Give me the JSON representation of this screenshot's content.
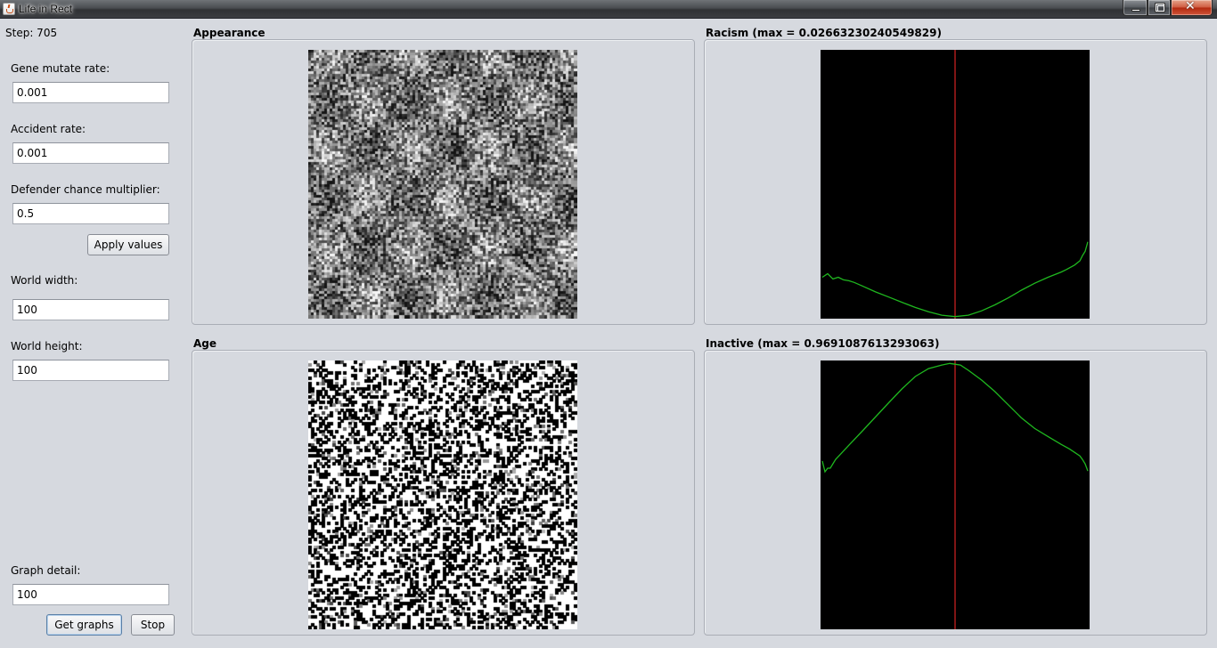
{
  "window": {
    "title": "Life in Rect"
  },
  "status": {
    "step": "Step: 705"
  },
  "controls": {
    "gene_mutate_rate": {
      "label": "Gene mutate rate:",
      "value": "0.001"
    },
    "accident_rate": {
      "label": "Accident rate:",
      "value": "0.001"
    },
    "defender_chance_multiplier": {
      "label": "Defender chance multiplier:",
      "value": "0.5"
    },
    "apply_button": "Apply values",
    "world_width": {
      "label": "World width:",
      "value": "100"
    },
    "world_height": {
      "label": "World height:",
      "value": "100"
    },
    "graph_detail": {
      "label": "Graph detail:",
      "value": "100"
    },
    "get_graphs_button": "Get graphs",
    "stop_button": "Stop"
  },
  "panels": {
    "appearance": {
      "title": "Appearance"
    },
    "age": {
      "title": "Age"
    },
    "racism": {
      "title": "Racism (max = 0.02663230240549829)"
    },
    "inactive": {
      "title": "Inactive (max = 0.9691087613293063)"
    }
  },
  "colors": {
    "graph_background": "#000000",
    "graph_line": "#1fb81f",
    "marker_line": "#ff2a2a"
  },
  "chart_data": [
    {
      "type": "line",
      "title": "Racism (max = 0.02663230240549829)",
      "xlim": [
        0,
        100
      ],
      "ylim": [
        0,
        0.02663230240549829
      ],
      "marker_x": 50,
      "series": [
        {
          "x": [
            0,
            2,
            4,
            6,
            8,
            10,
            12,
            15,
            20,
            25,
            30,
            35,
            40,
            45,
            50,
            55,
            60,
            65,
            70,
            75,
            80,
            85,
            90,
            92,
            95,
            97,
            98,
            99,
            100
          ],
          "values": [
            0.00398,
            0.00433,
            0.00381,
            0.00398,
            0.00372,
            0.00363,
            0.00346,
            0.00311,
            0.00251,
            0.00199,
            0.00147,
            0.00095,
            0.00052,
            0.00017,
            3e-05,
            0.00017,
            0.00061,
            0.00121,
            0.0019,
            0.00268,
            0.00338,
            0.00398,
            0.0045,
            0.00476,
            0.0052,
            0.00563,
            0.00615,
            0.00658,
            0.00753
          ]
        }
      ]
    },
    {
      "type": "line",
      "title": "Inactive (max = 0.9691087613293063)",
      "xlim": [
        0,
        100
      ],
      "ylim": [
        0,
        0.9691087613293063
      ],
      "marker_x": 50,
      "series": [
        {
          "x": [
            0,
            1,
            2,
            3,
            5,
            10,
            15,
            20,
            25,
            30,
            35,
            40,
            45,
            48,
            50,
            52,
            55,
            60,
            65,
            70,
            75,
            80,
            85,
            90,
            93,
            95,
            97,
            98,
            99,
            100
          ],
          "values": [
            0.608,
            0.569,
            0.582,
            0.582,
            0.614,
            0.666,
            0.717,
            0.769,
            0.821,
            0.872,
            0.917,
            0.946,
            0.959,
            0.965,
            0.962,
            0.959,
            0.94,
            0.904,
            0.862,
            0.814,
            0.766,
            0.727,
            0.698,
            0.669,
            0.653,
            0.64,
            0.627,
            0.614,
            0.598,
            0.572
          ]
        }
      ]
    }
  ]
}
